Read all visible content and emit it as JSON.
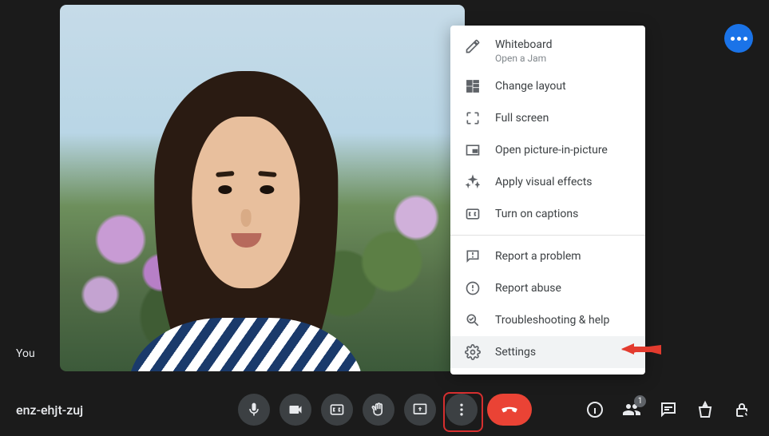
{
  "participant_label": "You",
  "meeting_code": "enz-ehjt-zuj",
  "menu": {
    "whiteboard": {
      "label": "Whiteboard",
      "sub": "Open a Jam"
    },
    "change_layout": "Change layout",
    "full_screen": "Full screen",
    "pip": "Open picture-in-picture",
    "visual_effects": "Apply visual effects",
    "captions": "Turn on captions",
    "report_problem": "Report a problem",
    "report_abuse": "Report abuse",
    "troubleshoot": "Troubleshooting & help",
    "settings": "Settings"
  },
  "participants_count": "1"
}
